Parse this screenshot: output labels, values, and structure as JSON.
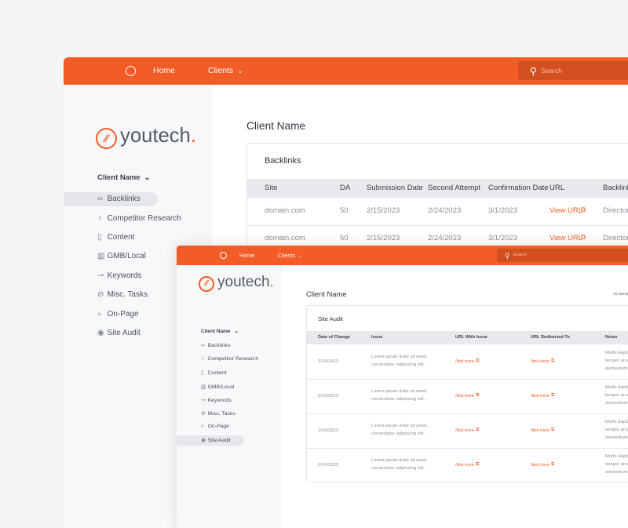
{
  "colors": {
    "brand": "#f25c26",
    "search_bg": "#d24f1f",
    "sidebar_bg": "#f7f8fa",
    "table_header": "#e8e9ec"
  },
  "logo": {
    "text": "youtech",
    "dot": "."
  },
  "nav": {
    "home": "Home",
    "clients": "Clients",
    "search_placeholder": "Search"
  },
  "sidebar": {
    "client": "Client Name",
    "items": [
      {
        "label": "Backlinks",
        "icon": "link-icon"
      },
      {
        "label": "Competitor Research",
        "icon": "trophy-icon"
      },
      {
        "label": "Content",
        "icon": "document-icon"
      },
      {
        "label": "GMB/Local",
        "icon": "building-icon"
      },
      {
        "label": "Keywords",
        "icon": "key-icon"
      },
      {
        "label": "Misc. Tasks",
        "icon": "check-circle-icon"
      },
      {
        "label": "On-Page",
        "icon": "search-page-icon"
      },
      {
        "label": "Site Audit",
        "icon": "eye-icon"
      }
    ]
  },
  "back": {
    "title": "Client Name",
    "card_title": "Backlinks",
    "active": "Backlinks",
    "columns": [
      "Site",
      "DA",
      "Submission Date",
      "Second Attempt",
      "Confirmation Date",
      "URL",
      "Backlinks"
    ],
    "rows": [
      [
        "domain.com",
        "50",
        "2/15/2023",
        "2/24/2023",
        "3/1/2023",
        "View URL",
        "Directory"
      ],
      [
        "domain.com",
        "50",
        "2/15/2023",
        "2/24/2023",
        "3/1/2023",
        "View URL",
        "Directory"
      ]
    ]
  },
  "front": {
    "title": "Client Name",
    "all_clients": "All Clients",
    "card_title": "Site Audit",
    "active": "Site Audit",
    "columns": [
      "Date of Change",
      "Issue",
      "URL With Issue",
      "URL Redirected To",
      "Notes"
    ],
    "rows": [
      [
        "2/24/2023",
        "Lorem ipsum dolor sit amet,",
        "consectetur adipiscing elit.",
        "/link-here",
        "/link-here",
        "Morbi dapibus",
        "tempor arcu",
        "elementum"
      ],
      [
        "2/24/2023",
        "Lorem ipsum dolor sit amet,",
        "consectetur adipiscing elit.",
        "/link-here",
        "/link-here",
        "Morbi dapibus",
        "tempor arcu",
        "elementum"
      ],
      [
        "2/24/2023",
        "Lorem ipsum dolor sit amet,",
        "consectetur adipiscing elit.",
        "/link-here",
        "/link-here",
        "Morbi dapibus",
        "tempor arcu",
        "elementum"
      ],
      [
        "2/24/2023",
        "Lorem ipsum dolor sit amet,",
        "consectetur adipiscing elit.",
        "/link-here",
        "/link-here",
        "Morbi dapibus",
        "tempor arcu",
        "elementum"
      ]
    ]
  }
}
